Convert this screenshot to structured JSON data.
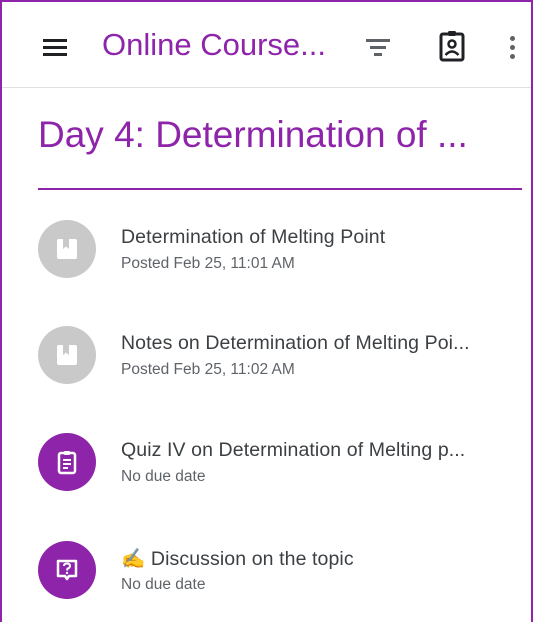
{
  "appbar": {
    "menu_icon": "menu-icon",
    "title": "Online Course...",
    "filter_icon": "filter-icon",
    "badge_icon": "assignment-ind-icon",
    "more_icon": "more-vert-icon"
  },
  "topic": {
    "title": "Day 4: Determination of ..."
  },
  "items": [
    {
      "icon": "material-icon",
      "title": "Determination of Melting Point",
      "subtitle": "Posted Feb 25, 11:01 AM"
    },
    {
      "icon": "material-icon",
      "title": "Notes on Determination of Melting Poi...",
      "subtitle": "Posted Feb 25, 11:02 AM"
    },
    {
      "icon": "assignment-icon",
      "title": "Quiz IV on Determination of Melting p...",
      "subtitle": "No due date"
    },
    {
      "icon": "question-icon",
      "title": "✍️ Discussion on the topic",
      "subtitle": "No due date"
    }
  ],
  "colors": {
    "accent": "#8e24aa",
    "icon_grey": "#c9c9c9",
    "text_primary": "#3c4043",
    "text_secondary": "#5f6368"
  }
}
